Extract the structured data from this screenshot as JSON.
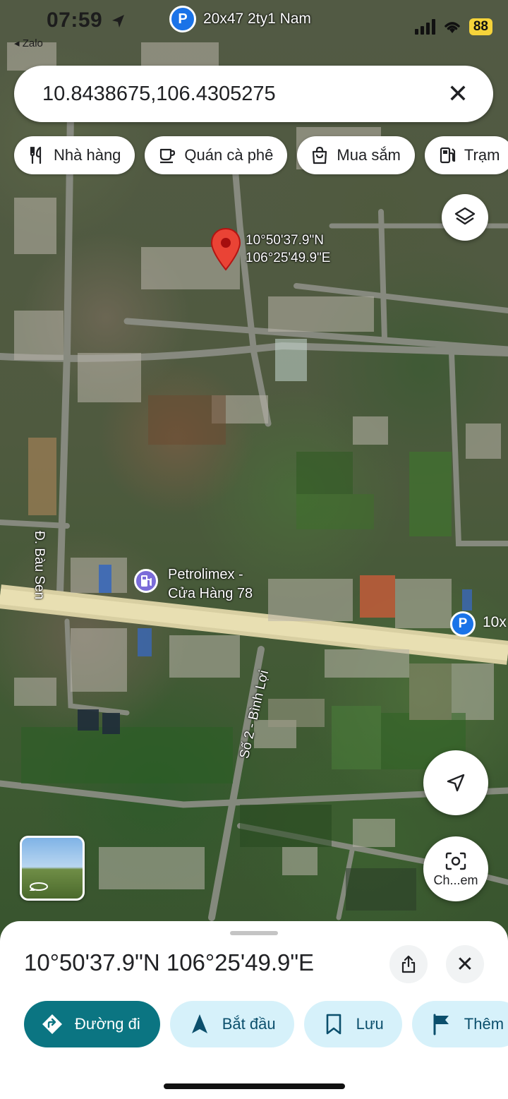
{
  "status_bar": {
    "time": "07:59",
    "back_app": "◂ Zalo",
    "battery": "88"
  },
  "top_pin": {
    "icon": "P",
    "label": "20x47 2ty1 Nam"
  },
  "search": {
    "value": "10.8438675,106.4305275"
  },
  "chips": [
    {
      "icon": "restaurant-icon",
      "label": "Nhà hàng"
    },
    {
      "icon": "coffee-icon",
      "label": "Quán cà phê"
    },
    {
      "icon": "shopping-bag-icon",
      "label": "Mua sắm"
    },
    {
      "icon": "gas-station-icon",
      "label": "Trạm"
    }
  ],
  "dropped_pin": {
    "lat": "10°50'37.9\"N",
    "lng": "106°25'49.9\"E"
  },
  "map_labels": {
    "road_bau_sen": "Đ. Bàu Sen",
    "road_binh_loi": "Số 2 - Bình Lợi",
    "poi_name": "Petrolimex -",
    "poi_name_2": "Cửa Hàng 78",
    "p_pin_icon": "P",
    "p_pin_label": "10x"
  },
  "camera_button": {
    "label": "Ch...em"
  },
  "sheet": {
    "title": "10°50'37.9\"N 106°25'49.9\"E",
    "actions": [
      {
        "icon": "directions-icon",
        "label": "Đường đi"
      },
      {
        "icon": "navigation-arrow-icon",
        "label": "Bắt đầu"
      },
      {
        "icon": "bookmark-icon",
        "label": "Lưu"
      },
      {
        "icon": "flag-icon",
        "label": "Thêm"
      }
    ]
  },
  "colors": {
    "primary_action": "#0b7582",
    "secondary_action": "#d6f1fa",
    "pin_red": "#ea4335",
    "parking_blue": "#1a73e8",
    "gas_poi": "#7b6cd9"
  }
}
